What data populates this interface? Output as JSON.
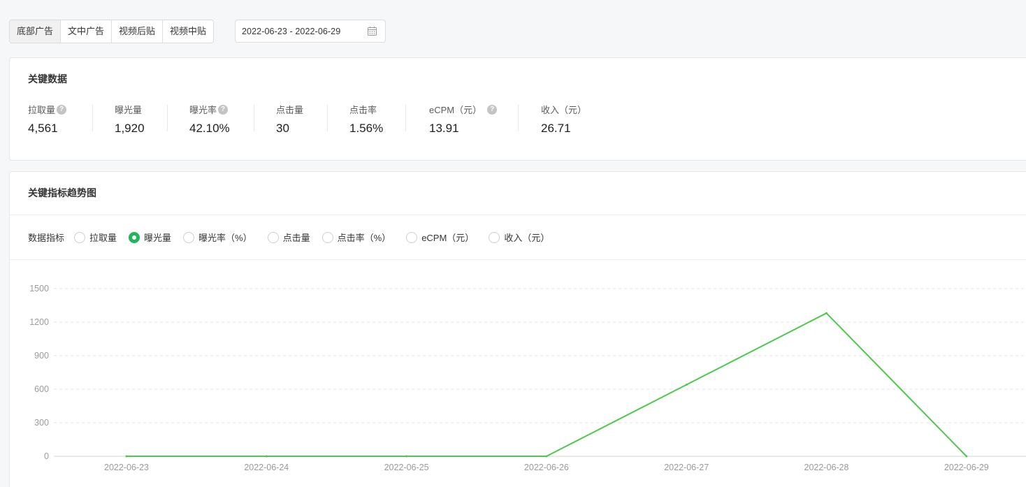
{
  "toolbar": {
    "tabs": [
      {
        "label": "底部广告",
        "active": true
      },
      {
        "label": "文中广告",
        "active": false
      },
      {
        "label": "视频后贴",
        "active": false
      },
      {
        "label": "视频中贴",
        "active": false
      }
    ],
    "date_range": "2022-06-23 - 2022-06-29",
    "date_icon": "calendar-icon"
  },
  "key_data": {
    "title": "关键数据",
    "metrics": [
      {
        "label": "拉取量",
        "value": "4,561",
        "help": true
      },
      {
        "label": "曝光量",
        "value": "1,920",
        "help": false
      },
      {
        "label": "曝光率",
        "value": "42.10%",
        "help": true
      },
      {
        "label": "点击量",
        "value": "30",
        "help": false
      },
      {
        "label": "点击率",
        "value": "1.56%",
        "help": false
      },
      {
        "label": "eCPM（元）",
        "value": "13.91",
        "help": true
      },
      {
        "label": "收入（元）",
        "value": "26.71",
        "help": false
      }
    ]
  },
  "trend": {
    "title": "关键指标趋势图",
    "filter_label": "数据指标",
    "options": [
      {
        "label": "拉取量",
        "checked": false
      },
      {
        "label": "曝光量",
        "checked": true
      },
      {
        "label": "曝光率（%）",
        "checked": false
      },
      {
        "label": "点击量",
        "checked": false
      },
      {
        "label": "点击率（%）",
        "checked": false
      },
      {
        "label": "eCPM（元）",
        "checked": false
      },
      {
        "label": "收入（元）",
        "checked": false
      }
    ]
  },
  "colors": {
    "accent": "#1fb55b",
    "line": "#4cc94c",
    "grid": "#e3e3e3",
    "axis_text": "#9a9a9a"
  },
  "chart_data": {
    "type": "line",
    "x": [
      "2022-06-23",
      "2022-06-24",
      "2022-06-25",
      "2022-06-26",
      "2022-06-27",
      "2022-06-28",
      "2022-06-29"
    ],
    "series": [
      {
        "values": [
          0,
          0,
          0,
          0,
          640,
          1280,
          0
        ]
      }
    ],
    "yticks": [
      0,
      300,
      600,
      900,
      1200,
      1500
    ],
    "ylim": [
      0,
      1500
    ],
    "grid": true,
    "title": "",
    "xlabel": "",
    "ylabel": ""
  }
}
